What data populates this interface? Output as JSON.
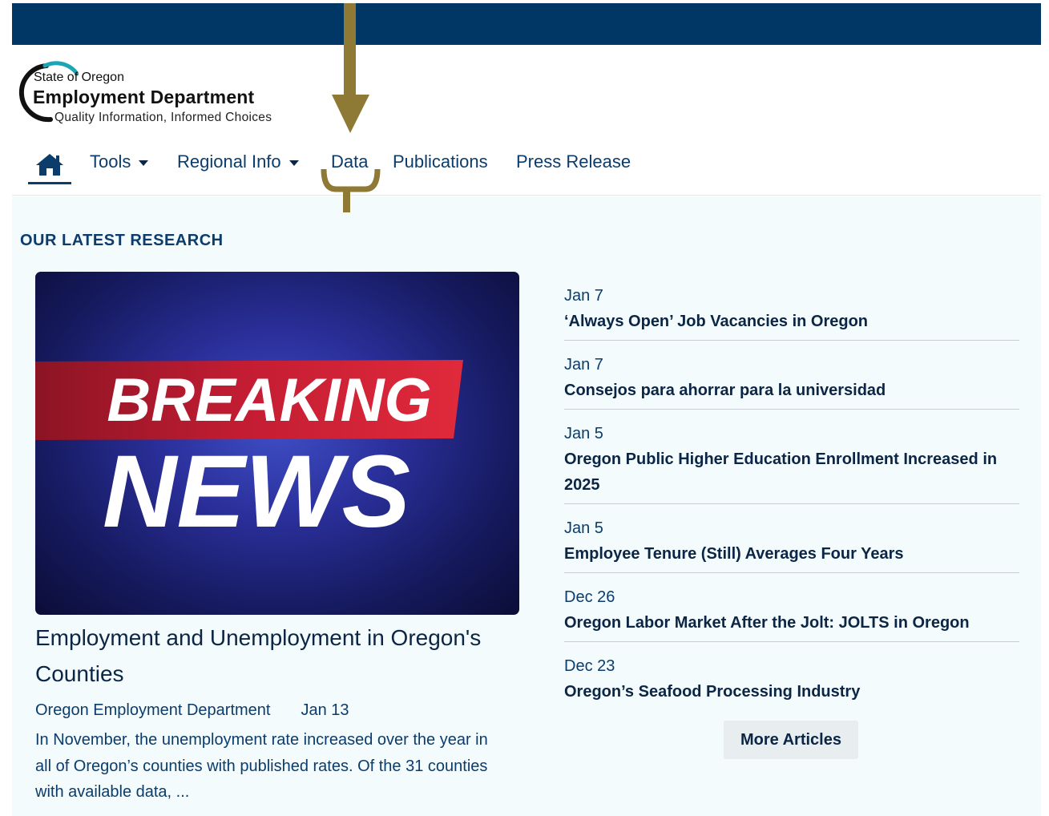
{
  "colors": {
    "topbar": "#003764",
    "accent": "#0b3c6b",
    "annotation": "#8e7a35",
    "content_bg": "#f3fbfd"
  },
  "logo": {
    "line1": "State of Oregon",
    "line2": "Employment Department",
    "line3": "Quality Information, Informed Choices"
  },
  "nav": {
    "home_icon": "home-icon",
    "items": [
      {
        "label": "Tools",
        "has_dropdown": true
      },
      {
        "label": "Regional Info",
        "has_dropdown": true
      },
      {
        "label": "Data",
        "has_dropdown": false
      },
      {
        "label": "Publications",
        "has_dropdown": false
      },
      {
        "label": "Press Release",
        "has_dropdown": false
      }
    ]
  },
  "section_title": "OUR LATEST RESEARCH",
  "feature": {
    "image_text": {
      "line1": "BREAKING",
      "line2": "NEWS"
    },
    "title": "Employment and Unemployment in Oregon's Counties",
    "author": "Oregon Employment Department",
    "date": "Jan 13",
    "description": "In November, the unemployment rate increased over the year in all of Oregon’s counties with published rates. Of the 31 counties with available data, ..."
  },
  "articles": [
    {
      "date": "Jan 7",
      "title": "‘Always Open’ Job Vacancies in Oregon"
    },
    {
      "date": "Jan 7",
      "title": "Consejos para ahorrar para la universidad"
    },
    {
      "date": "Jan 5",
      "title": "Oregon Public Higher Education Enrollment Increased in 2025"
    },
    {
      "date": "Jan 5",
      "title": "Employee Tenure (Still) Averages Four Years"
    },
    {
      "date": "Dec 26",
      "title": "Oregon Labor Market After the Jolt: JOLTS in Oregon"
    },
    {
      "date": "Dec 23",
      "title": "Oregon’s Seafood Processing Industry"
    }
  ],
  "more_button": "More Articles"
}
